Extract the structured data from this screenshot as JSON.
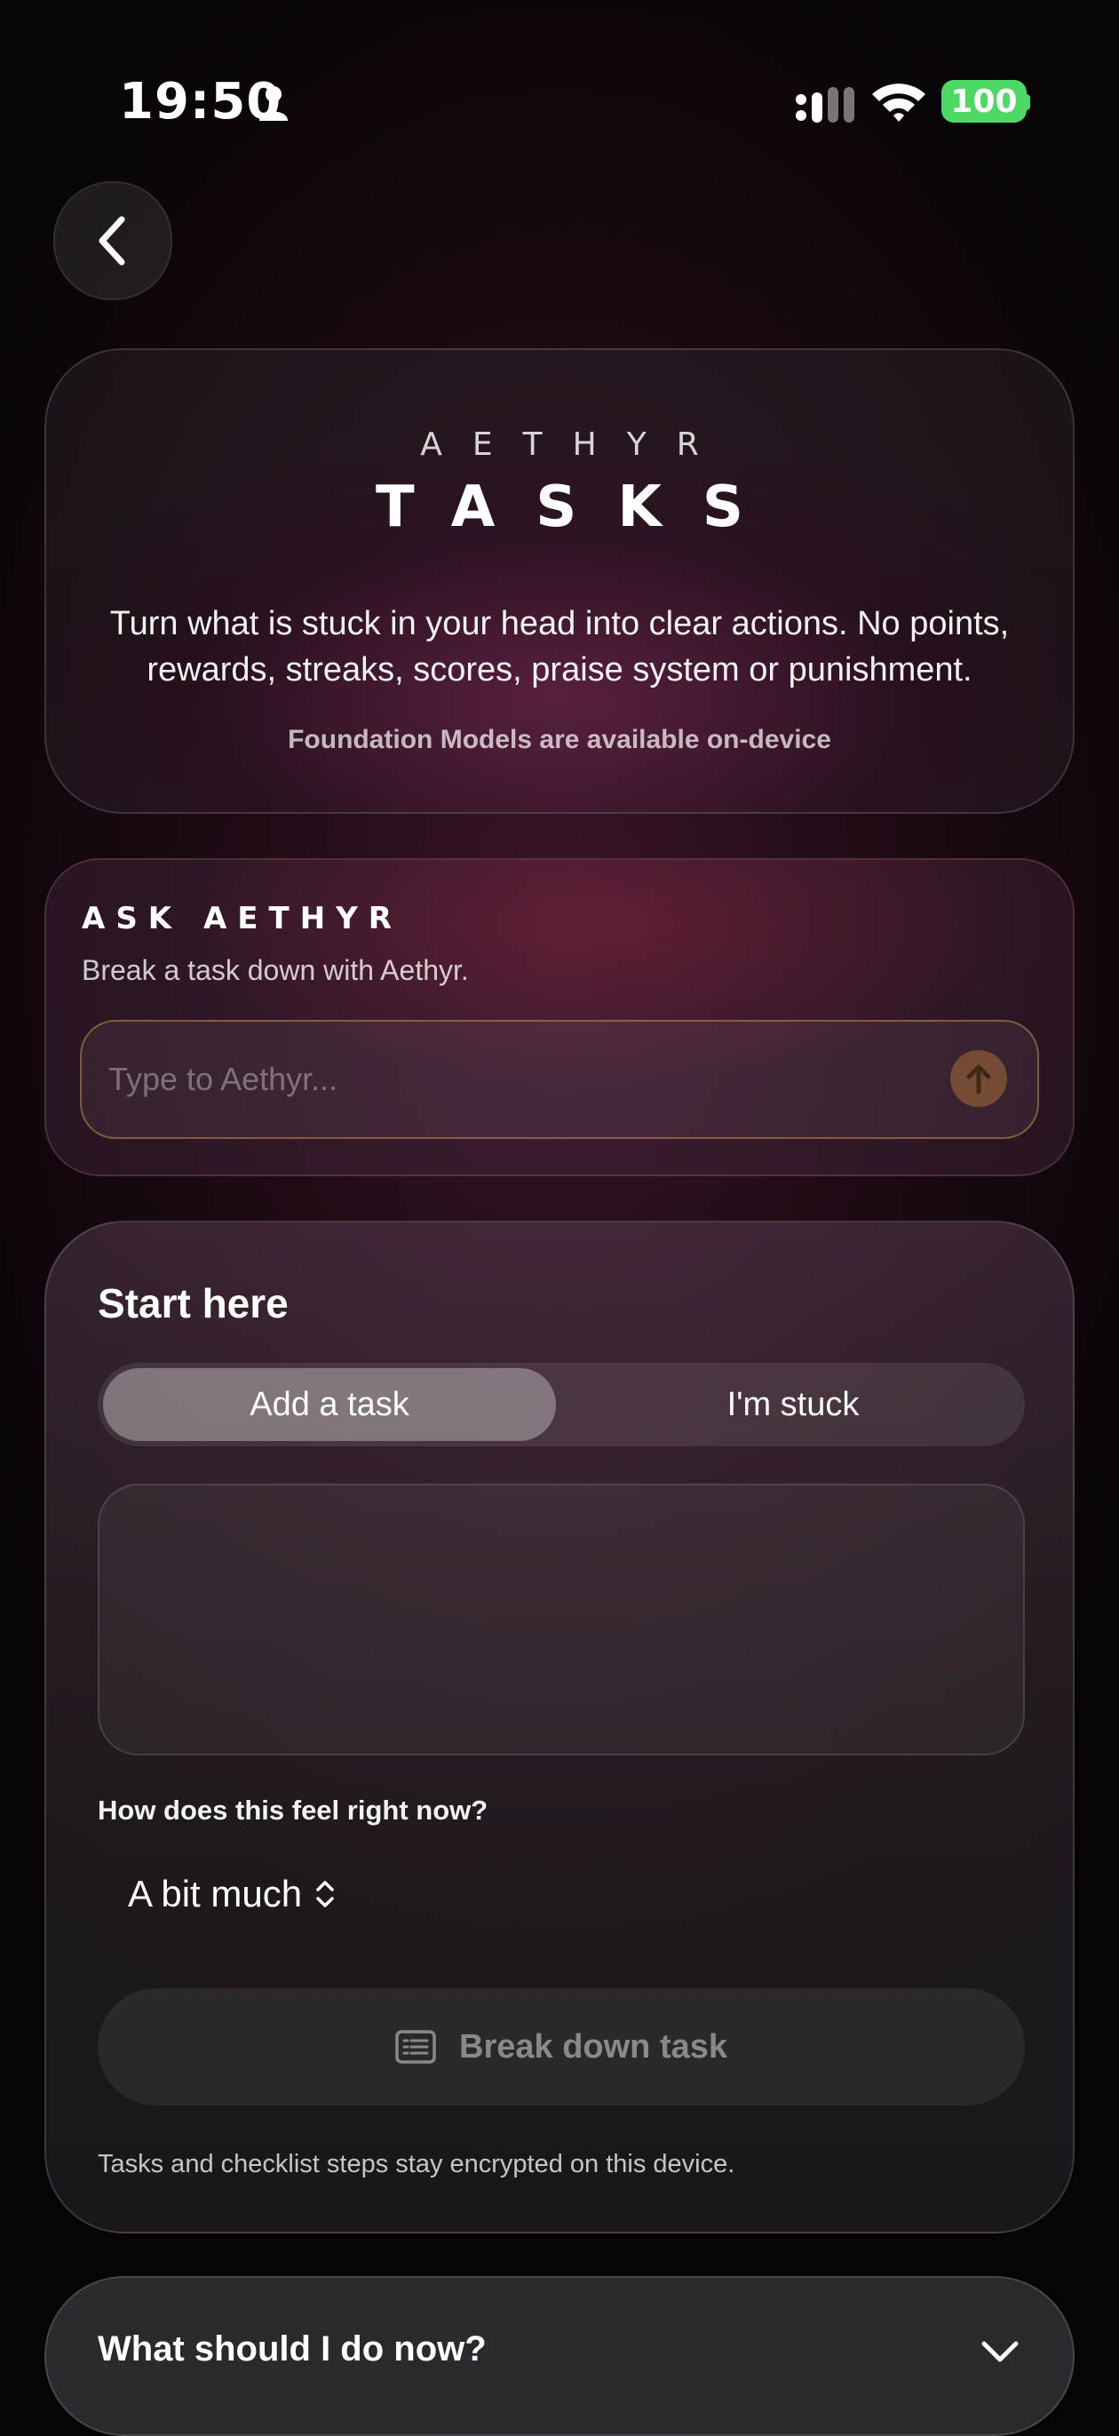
{
  "status_bar": {
    "time": "19:50",
    "battery": "100"
  },
  "hero": {
    "brand": "AETHYR",
    "title": "TASKS",
    "description": "Turn what is stuck in your head into clear actions. No points, rewards, streaks, scores, praise system or punishment.",
    "note": "Foundation Models are available on-device"
  },
  "ask": {
    "title": "ASK AETHYR",
    "subtitle": "Break a task down with Aethyr.",
    "placeholder": "Type to Aethyr..."
  },
  "start": {
    "title": "Start here",
    "tabs": [
      {
        "label": "Add a task",
        "selected": true
      },
      {
        "label": "I'm stuck",
        "selected": false
      }
    ],
    "feel_label": "How does this feel right now?",
    "feel_value": "A bit much",
    "break_button": "Break down task",
    "footnote": "Tasks and checklist steps stay encrypted on this device."
  },
  "now": {
    "title": "What should I do now?"
  },
  "colors": {
    "battery": "#4cd964",
    "accent_input_border": "#be8c46"
  }
}
